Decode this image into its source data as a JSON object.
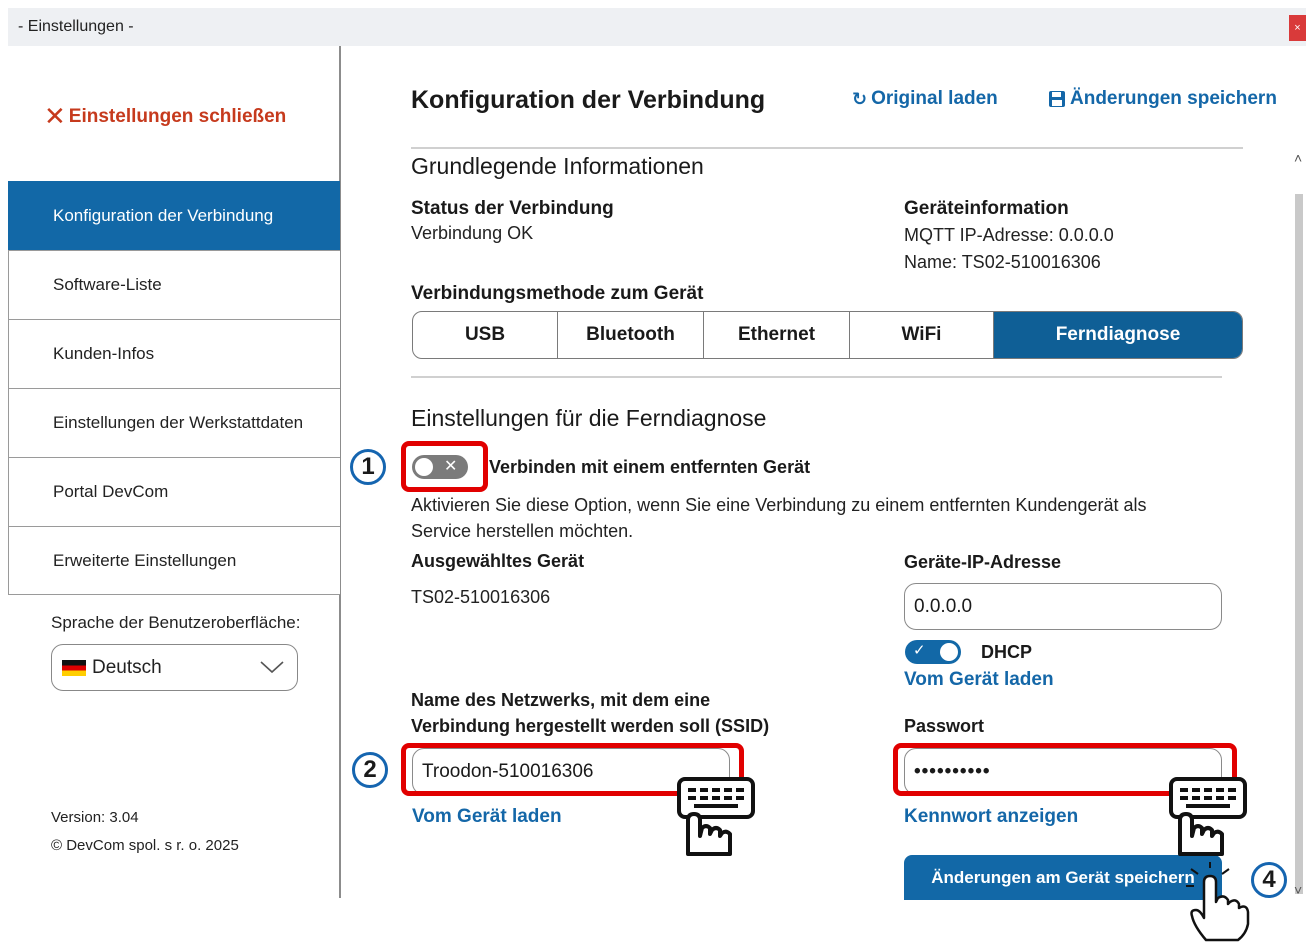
{
  "window": {
    "title": "- Einstellungen -",
    "close_glyph": "×"
  },
  "sidebar": {
    "close_label": "Einstellungen schließen",
    "items": [
      {
        "label": "Konfiguration der Verbindung",
        "active": true
      },
      {
        "label": "Software-Liste"
      },
      {
        "label": "Kunden-Infos"
      },
      {
        "label": "Einstellungen der Werkstattdaten"
      },
      {
        "label": "Portal DevCom"
      },
      {
        "label": "Erweiterte Einstellungen"
      }
    ],
    "language_label": "Sprache der Benutzeroberfläche:",
    "language_value": "Deutsch",
    "version": "Version: 3.04",
    "copyright": "© DevCom spol. s r. o. 2025"
  },
  "header": {
    "title": "Konfiguration der Verbindung",
    "reload_label": "Original laden",
    "save_label": "Änderungen speichern"
  },
  "basic": {
    "title": "Grundlegende Informationen",
    "status_label": "Status der Verbindung",
    "status_value": "Verbindung OK",
    "device_info_label": "Geräteinformation",
    "mqtt": "MQTT IP-Adresse: 0.0.0.0",
    "name": "Name: TS02-510016306",
    "method_label": "Verbindungsmethode zum Gerät",
    "methods": [
      "USB",
      "Bluetooth",
      "Ethernet",
      "WiFi",
      "Ferndiagnose"
    ],
    "active_method": "Ferndiagnose"
  },
  "remote": {
    "title": "Einstellungen für die Ferndiagnose",
    "toggle_label": "Verbinden mit einem entfernten Gerät",
    "toggle_on": false,
    "desc_line1": "Aktivieren Sie diese Option, wenn Sie eine Verbindung zu einem entfernten Kundengerät als",
    "desc_line2": "Service herstellen möchten.",
    "selected_label": "Ausgewähltes Gerät",
    "selected_value": "TS02-510016306",
    "ip_label": "Geräte-IP-Adresse",
    "ip_value": "0.0.0.0",
    "dhcp_label": "DHCP",
    "dhcp_on": true,
    "load_from_device": "Vom Gerät laden",
    "ssid_label_line1": "Name des Netzwerks, mit dem eine",
    "ssid_label_line2": "Verbindung hergestellt werden soll (SSID)",
    "ssid_value": "Troodon-510016306",
    "ssid_load": "Vom Gerät laden",
    "password_label": "Passwort",
    "password_value": "••••••••••",
    "show_password": "Kennwort anzeigen",
    "save_device_button": "Änderungen am Gerät speichern"
  },
  "annotations": {
    "steps": [
      "1",
      "2",
      "4"
    ],
    "highlight_color": "#e10000",
    "step_border_color": "#1565b0"
  },
  "colors": {
    "accent": "#1268a7",
    "close_red": "#c63a1d"
  },
  "icons": [
    "close-x-icon",
    "reload-icon",
    "save-disk-icon",
    "chevron-down-icon",
    "flag-de-icon",
    "keyboard-touch-icon",
    "tap-hand-icon"
  ]
}
